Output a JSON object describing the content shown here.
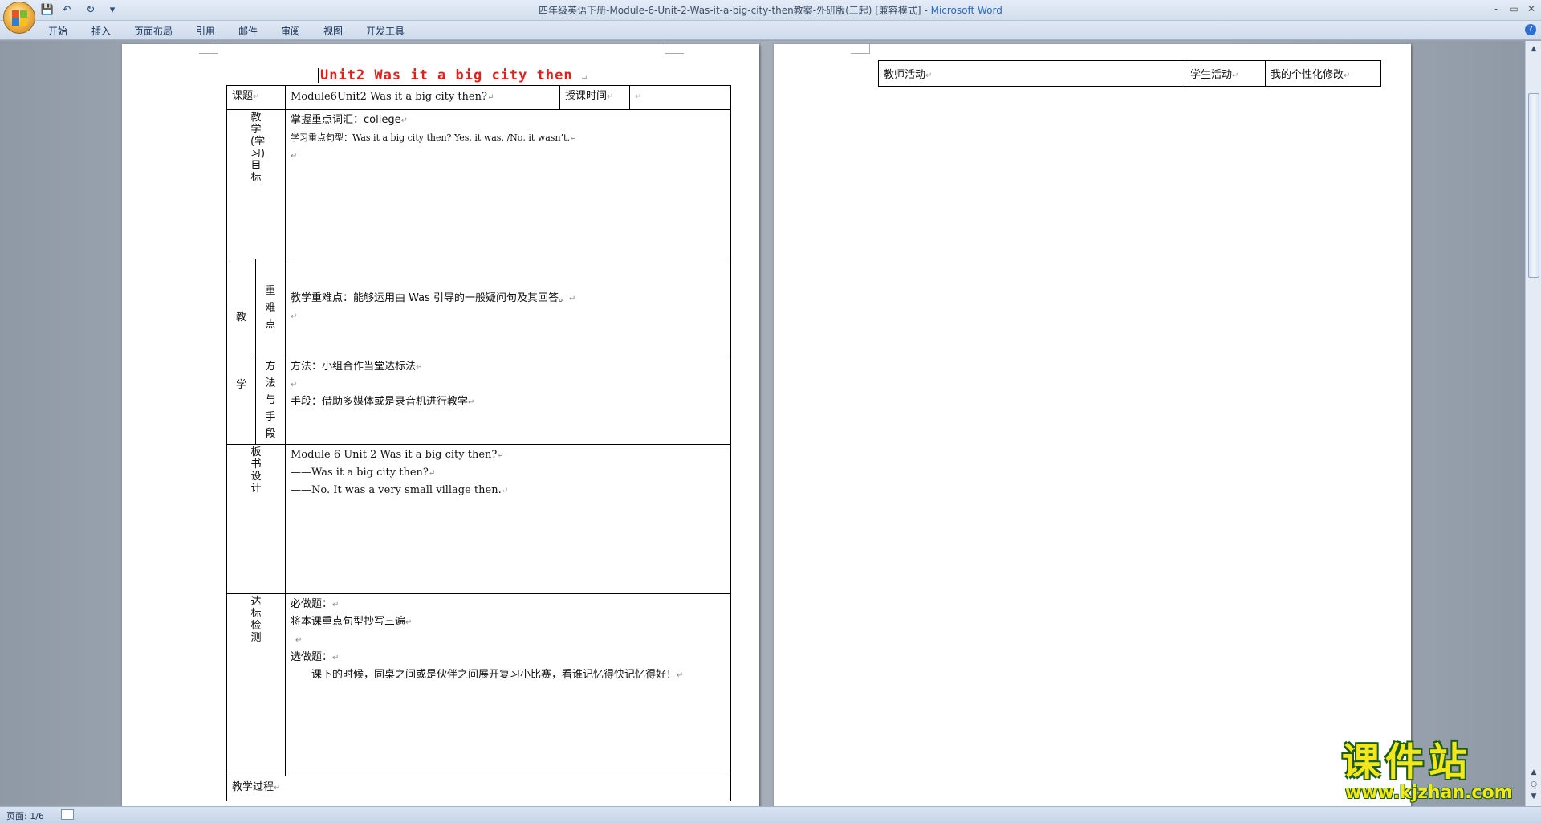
{
  "window": {
    "title": "四年级英语下册-Module-6-Unit-2-Was-it-a-big-city-then教案-外研版(三起) [兼容模式]",
    "separator": " - ",
    "app_name": "Microsoft Word",
    "controls": {
      "minimize": "-",
      "restore": "▭",
      "close": "✕"
    }
  },
  "qat": {
    "save": "💾",
    "undo": "↶",
    "redo": "↻",
    "customize": "▾"
  },
  "ribbon": {
    "tabs": [
      "开始",
      "插入",
      "页面布局",
      "引用",
      "邮件",
      "审阅",
      "视图",
      "开发工具"
    ],
    "help": "?"
  },
  "doc": {
    "title": "Unit2 Was it a big city then",
    "mark": "↵",
    "rows": {
      "topic_label": "课题",
      "topic_value": "Module6Unit2 Was it a big city then?",
      "time_label": "授课时间",
      "goals_label": "教学(学习)目标",
      "goals_line1": "掌握重点词汇：college",
      "goals_line2": "学习重点句型：Was it a big city then? Yes, it was. /No, it wasn’t.",
      "teach_label": "教学",
      "keypoint_label": "重难点",
      "keypoint_value": "教学重难点：能够运用由 Was 引导的一般疑问句及其回答。",
      "method_label": "方法与手段",
      "method_line1": "方法：小组合作当堂达标法",
      "method_line2": "手段：借助多媒体或是录音机进行教学",
      "board_label": "板书设计",
      "board_line1": "Module 6 Unit 2 Was it a big city then?",
      "board_line2": "——Was  it a big city then?",
      "board_line3": "——No. It was a very small village then.",
      "test_label": "达标检测",
      "test_line1": "必做题：",
      "test_line2": "将本课重点句型抄写三遍",
      "test_line3": "选做题：",
      "test_line4": "课下的时候，同桌之间或是伙伴之间展开复习小比赛，看谁记忆得快记忆得好！",
      "process_label": "教学过程"
    },
    "page2": {
      "col1": "教师活动",
      "col2": "学生活动",
      "col3": "我的个性化修改"
    }
  },
  "statusbar": {
    "page": "页面: 1/6"
  },
  "watermark": {
    "brand": "课件站",
    "url": "www.kjzhan.com"
  },
  "colors": {
    "title_red": "#e0201a",
    "watermark_yellow": "#f3e61a",
    "watermark_green": "#1a5c18"
  }
}
